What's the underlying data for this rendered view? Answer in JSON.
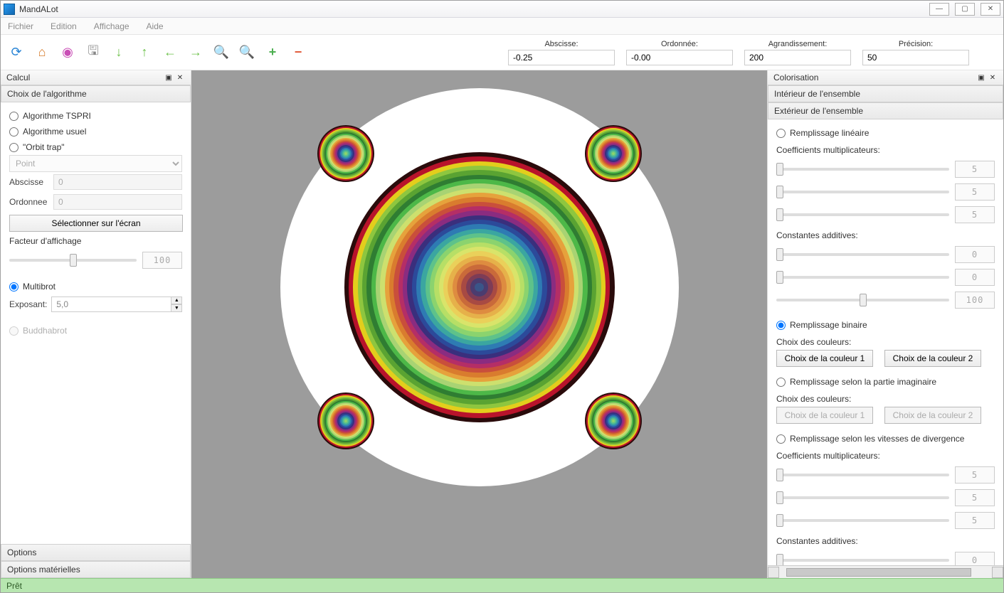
{
  "app": {
    "title": "MandALot"
  },
  "menu": [
    "Fichier",
    "Edition",
    "Affichage",
    "Aide"
  ],
  "toolbar_fields": {
    "abscisse_label": "Abscisse:",
    "abscisse_value": "-0.25",
    "ordonnee_label": "Ordonnée:",
    "ordonnee_value": "-0.00",
    "agrandissement_label": "Agrandissement:",
    "agrandissement_value": "200",
    "precision_label": "Précision:",
    "precision_value": "50"
  },
  "left": {
    "panel_title": "Calcul",
    "section1": "Choix de l'algorithme",
    "algo_tspri": "Algorithme TSPRI",
    "algo_usuel": "Algorithme usuel",
    "orbit_trap": "\"Orbit trap\"",
    "orbit_select": "Point",
    "abscisse_label": "Abscisse",
    "abscisse_value": "0",
    "ordonnee_label": "Ordonnee",
    "ordonnee_value": "0",
    "select_screen": "Sélectionner sur l'écran",
    "facteur_affichage": "Facteur d'affichage",
    "facteur_value": "100",
    "multibrot": "Multibrot",
    "exposant_label": "Exposant:",
    "exposant_value": "5,0",
    "buddhabrot": "Buddhabrot",
    "options": "Options",
    "options_mat": "Options matérielles"
  },
  "right": {
    "panel_title": "Colorisation",
    "interieur": "Intérieur de l'ensemble",
    "exterieur": "Extérieur de l'ensemble",
    "remp_lineaire": "Remplissage linéaire",
    "coeff_mult": "Coefficients multiplicateurs:",
    "const_add": "Constantes additives:",
    "remp_binaire": "Remplissage binaire",
    "choix_couleurs": "Choix des couleurs:",
    "btn_couleur1": "Choix de la couleur 1",
    "btn_couleur2": "Choix de la couleur 2",
    "remp_imag": "Remplissage selon la partie imaginaire",
    "remp_div": "Remplissage selon les vitesses de divergence",
    "slider_5": "5",
    "slider_0": "0",
    "slider_100": "100"
  },
  "status": {
    "text": "Prêt"
  }
}
